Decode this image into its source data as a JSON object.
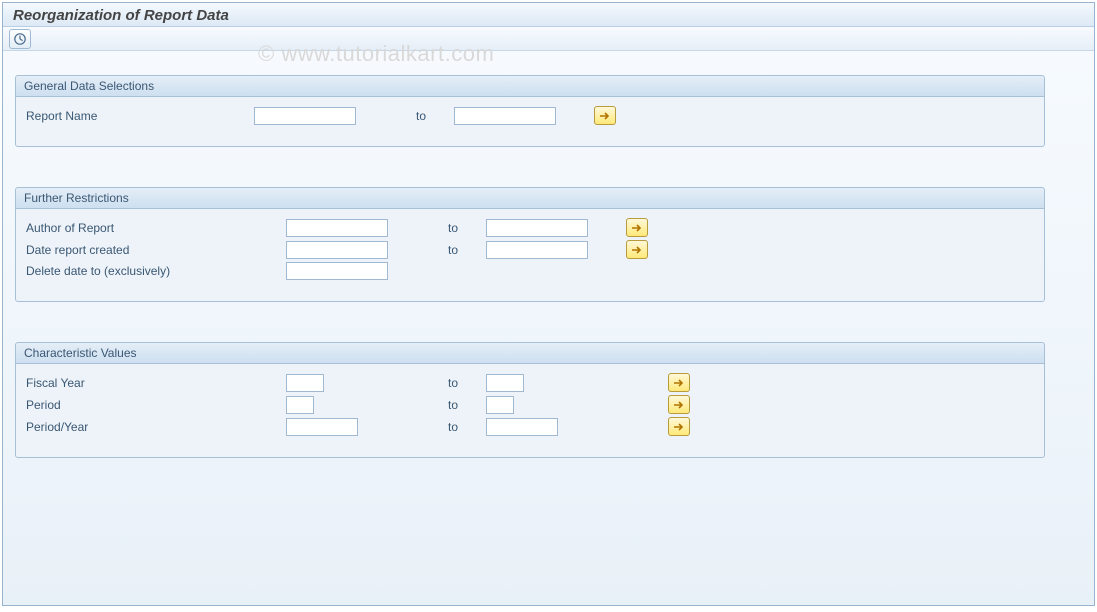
{
  "title": "Reorganization of Report Data",
  "watermark": "© www.tutorialkart.com",
  "groups": {
    "general": {
      "title": "General Data Selections",
      "report_name_label": "Report Name",
      "to_label": "to"
    },
    "further": {
      "title": "Further Restrictions",
      "author_label": "Author of Report",
      "date_created_label": "Date report created",
      "delete_date_label": "Delete date to (exclusively)",
      "to_label": "to"
    },
    "charval": {
      "title": "Characteristic Values",
      "fiscal_year_label": "Fiscal Year",
      "period_label": "Period",
      "period_year_label": "Period/Year",
      "to_label": "to"
    }
  }
}
